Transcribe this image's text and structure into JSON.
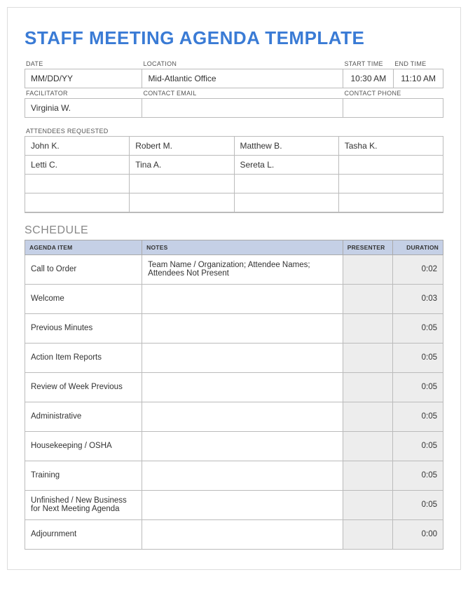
{
  "title": "STAFF MEETING AGENDA TEMPLATE",
  "labels": {
    "date": "DATE",
    "location": "LOCATION",
    "start_time": "START TIME",
    "end_time": "END TIME",
    "facilitator": "FACILITATOR",
    "contact_email": "CONTACT EMAIL",
    "contact_phone": "CONTACT PHONE",
    "attendees": "ATTENDEES REQUESTED"
  },
  "info": {
    "date": "MM/DD/YY",
    "location": "Mid-Atlantic Office",
    "start_time": "10:30 AM",
    "end_time": "11:10 AM",
    "facilitator": "Virginia W.",
    "contact_email": "",
    "contact_phone": ""
  },
  "attendees": [
    [
      "John K.",
      "Robert M.",
      "Matthew B.",
      "Tasha K."
    ],
    [
      "Letti C.",
      "Tina A.",
      "Sereta L.",
      ""
    ],
    [
      "",
      "",
      "",
      ""
    ],
    [
      "",
      "",
      "",
      ""
    ]
  ],
  "schedule_title": "SCHEDULE",
  "schedule_headers": {
    "item": "AGENDA ITEM",
    "notes": "NOTES",
    "presenter": "PRESENTER",
    "duration": "DURATION"
  },
  "schedule": [
    {
      "item": "Call to Order",
      "notes": "Team Name / Organization; Attendee Names; Attendees Not Present",
      "presenter": "",
      "duration": "0:02"
    },
    {
      "item": "Welcome",
      "notes": "",
      "presenter": "",
      "duration": "0:03"
    },
    {
      "item": "Previous Minutes",
      "notes": "",
      "presenter": "",
      "duration": "0:05"
    },
    {
      "item": "Action Item Reports",
      "notes": "",
      "presenter": "",
      "duration": "0:05"
    },
    {
      "item": "Review of Week Previous",
      "notes": "",
      "presenter": "",
      "duration": "0:05"
    },
    {
      "item": "Administrative",
      "notes": "",
      "presenter": "",
      "duration": "0:05"
    },
    {
      "item": "Housekeeping / OSHA",
      "notes": "",
      "presenter": "",
      "duration": "0:05"
    },
    {
      "item": "Training",
      "notes": "",
      "presenter": "",
      "duration": "0:05"
    },
    {
      "item": "Unfinished / New Business for Next Meeting Agenda",
      "notes": "",
      "presenter": "",
      "duration": "0:05"
    },
    {
      "item": "Adjournment",
      "notes": "",
      "presenter": "",
      "duration": "0:00"
    }
  ]
}
